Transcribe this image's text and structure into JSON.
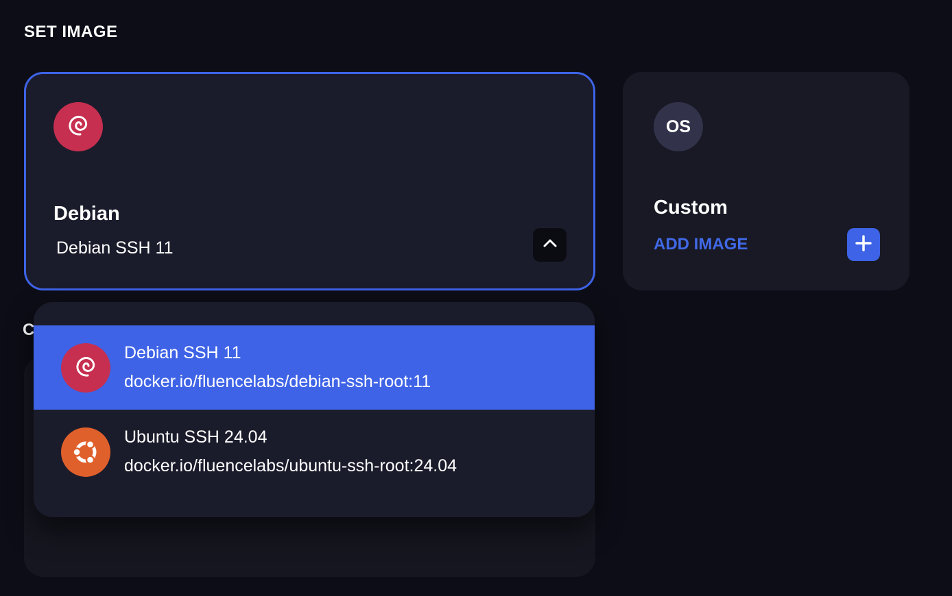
{
  "section": {
    "title": "SET IMAGE",
    "next_section_title": "C"
  },
  "selected_card": {
    "title": "Debian",
    "subtitle": "Debian SSH 11",
    "logo_icon": "debian-swirl-icon",
    "toggle_icon": "chevron-up-icon"
  },
  "custom_card": {
    "badge_text": "OS",
    "title": "Custom",
    "add_label": "ADD IMAGE",
    "add_icon": "plus-icon"
  },
  "dropdown": {
    "options": [
      {
        "name": "Debian SSH 11",
        "path": "docker.io/fluencelabs/debian-ssh-root:11",
        "icon": "debian-swirl-icon",
        "selected": true
      },
      {
        "name": "Ubuntu SSH 24.04",
        "path": "docker.io/fluencelabs/ubuntu-ssh-root:24.04",
        "icon": "ubuntu-circle-of-friends-icon",
        "selected": false
      }
    ]
  },
  "colors": {
    "accent": "#3e63e6",
    "background": "#0c0d16",
    "card": "#1b1c2b",
    "debian": "#c62f4f",
    "ubuntu": "#e0602b"
  }
}
